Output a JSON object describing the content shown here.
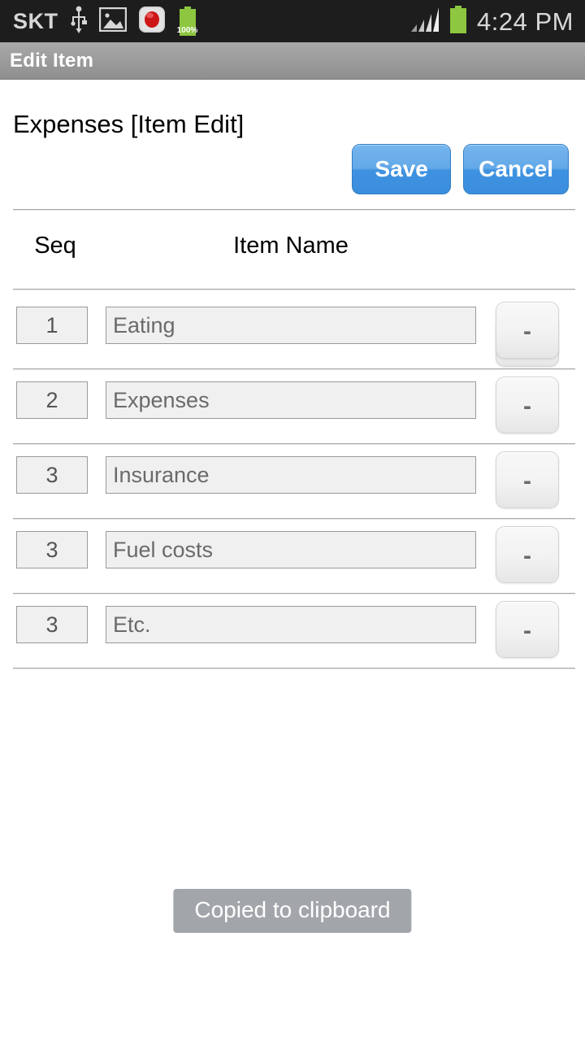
{
  "status_bar": {
    "carrier": "SKT",
    "battery_percent": "100%",
    "clock": "4:24 PM",
    "icons": [
      "usb-icon",
      "gallery-icon",
      "screen-record-icon",
      "battery-percent-icon",
      "signal-icon",
      "battery-icon"
    ]
  },
  "action_bar": {
    "title": "Edit Item"
  },
  "page": {
    "title": "Expenses [Item Edit]",
    "save_label": "Save",
    "cancel_label": "Cancel"
  },
  "table": {
    "columns": [
      "Seq",
      "Item Name"
    ],
    "add_label": "+",
    "remove_label": "-",
    "rows": [
      {
        "seq": "1",
        "name": "Eating"
      },
      {
        "seq": "2",
        "name": "Expenses"
      },
      {
        "seq": "3",
        "name": "Insurance"
      },
      {
        "seq": "3",
        "name": "Fuel costs"
      },
      {
        "seq": "3",
        "name": "Etc."
      }
    ]
  },
  "toast": {
    "message": "Copied to clipboard"
  },
  "colors": {
    "status_bar_bg": "#1d1d1d",
    "action_bar_bg": "#9d9d9d",
    "accent_blue": "#3f92e0",
    "battery_green": "#8dc63f",
    "field_bg": "#f0f0f0",
    "toast_bg": "#a2a6aa"
  }
}
